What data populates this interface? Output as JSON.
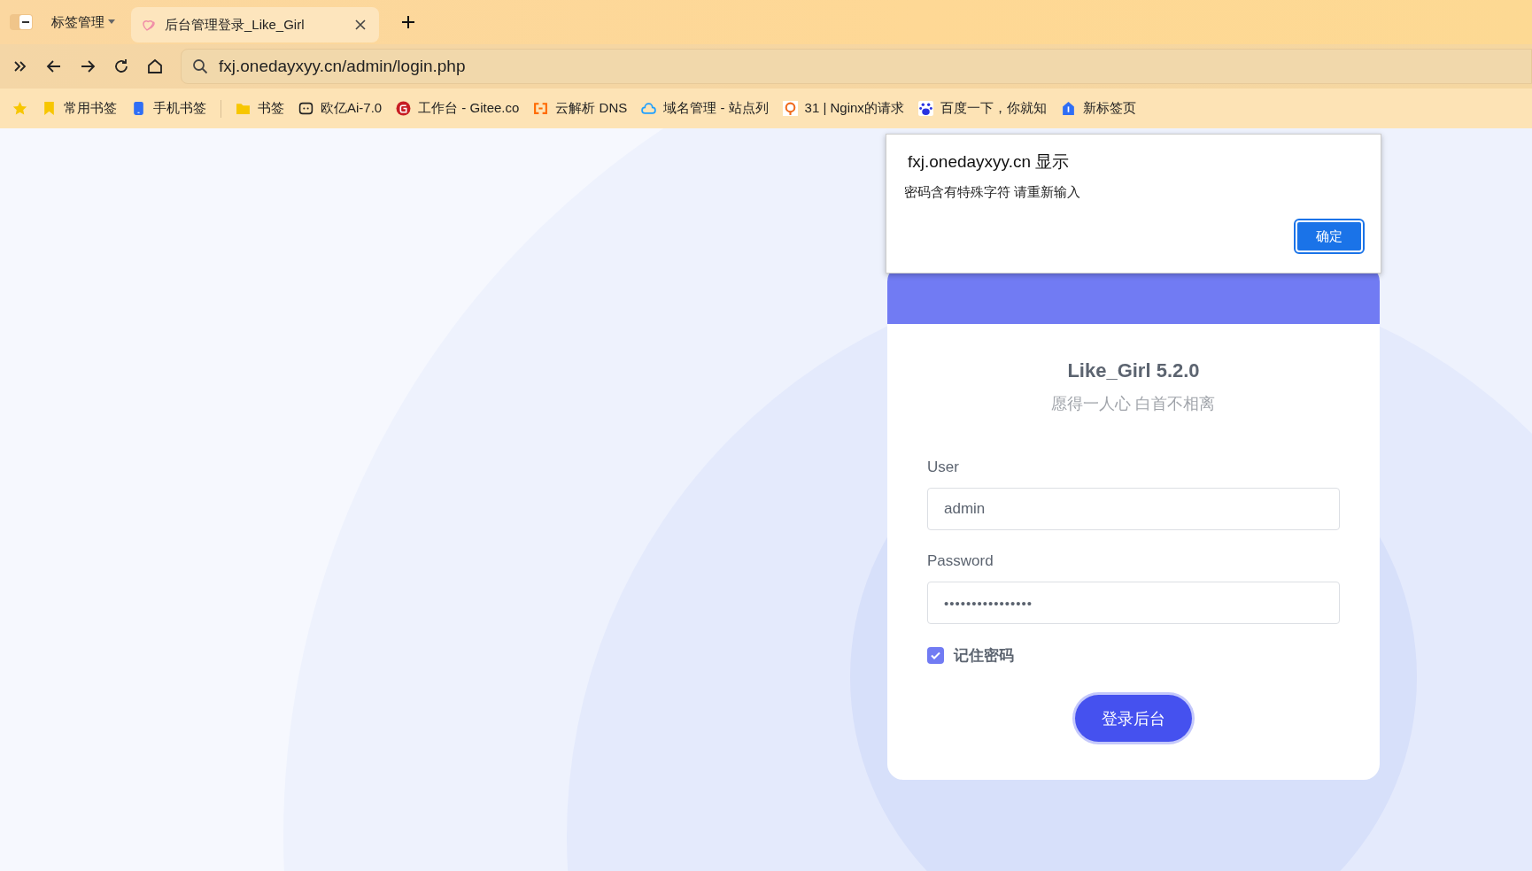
{
  "browser": {
    "tab_group_label": "标签管理",
    "tabs": [
      {
        "title": "后台管理登录_Like_Girl",
        "selected": true
      }
    ],
    "address": "fxj.onedayxyy.cn/admin/login.php",
    "bookmarks": [
      {
        "label": "常用书签",
        "kind": "bookmark"
      },
      {
        "label": "手机书签",
        "kind": "phone"
      },
      {
        "label": "书签",
        "kind": "folder"
      },
      {
        "label": "欧亿Ai-7.0",
        "kind": "bot"
      },
      {
        "label": "工作台 - Gitee.co",
        "kind": "gitee"
      },
      {
        "label": "云解析 DNS",
        "kind": "cloudbracket"
      },
      {
        "label": "域名管理 - 站点列",
        "kind": "cloud"
      },
      {
        "label": "31 | Nginx的请求",
        "kind": "geek"
      },
      {
        "label": "百度一下，你就知",
        "kind": "paw"
      },
      {
        "label": "新标签页",
        "kind": "home"
      }
    ]
  },
  "dialog": {
    "title": "fxj.onedayxyy.cn 显示",
    "message": "密码含有特殊字符 请重新输入",
    "button": "确定"
  },
  "login": {
    "title": "Like_Girl 5.2.0",
    "subtitle": "愿得一人心 白首不相离",
    "user_label": "User",
    "user_value": "admin",
    "password_label": "Password",
    "password_value": "••••••••••••••••",
    "remember": {
      "label": "记住密码",
      "checked": true
    },
    "submit": "登录后台"
  }
}
